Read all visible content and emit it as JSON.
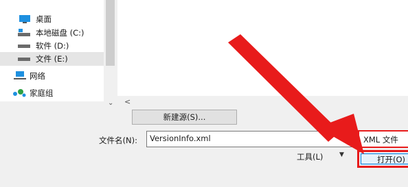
{
  "nav_pane": {
    "items": [
      {
        "label": "桌面",
        "icon": "desktop-icon"
      },
      {
        "label": "本地磁盘 (C:)",
        "icon": "system-drive-icon"
      },
      {
        "label": "软件 (D:)",
        "icon": "drive-icon"
      },
      {
        "label": "文件 (E:)",
        "icon": "drive-icon",
        "selected": true
      },
      {
        "label": "网络",
        "icon": "network-icon"
      },
      {
        "label": "家庭组",
        "icon": "homegroup-icon"
      }
    ]
  },
  "new_source_button": "新建源(S)...",
  "filename": {
    "label": "文件名(N):",
    "value": "VersionInfo.xml"
  },
  "filetype": {
    "value": "XML 文件"
  },
  "tools": {
    "label": "工具(L)",
    "arrow": "▼"
  },
  "open_button": "打开(O)",
  "scroll": {
    "down_arrow": "⌄",
    "left_arrow": "<"
  },
  "colors": {
    "highlight_red": "#e81b1b",
    "selection_grey": "#e5e5e5",
    "dialog_bg": "#f0f0f0"
  }
}
